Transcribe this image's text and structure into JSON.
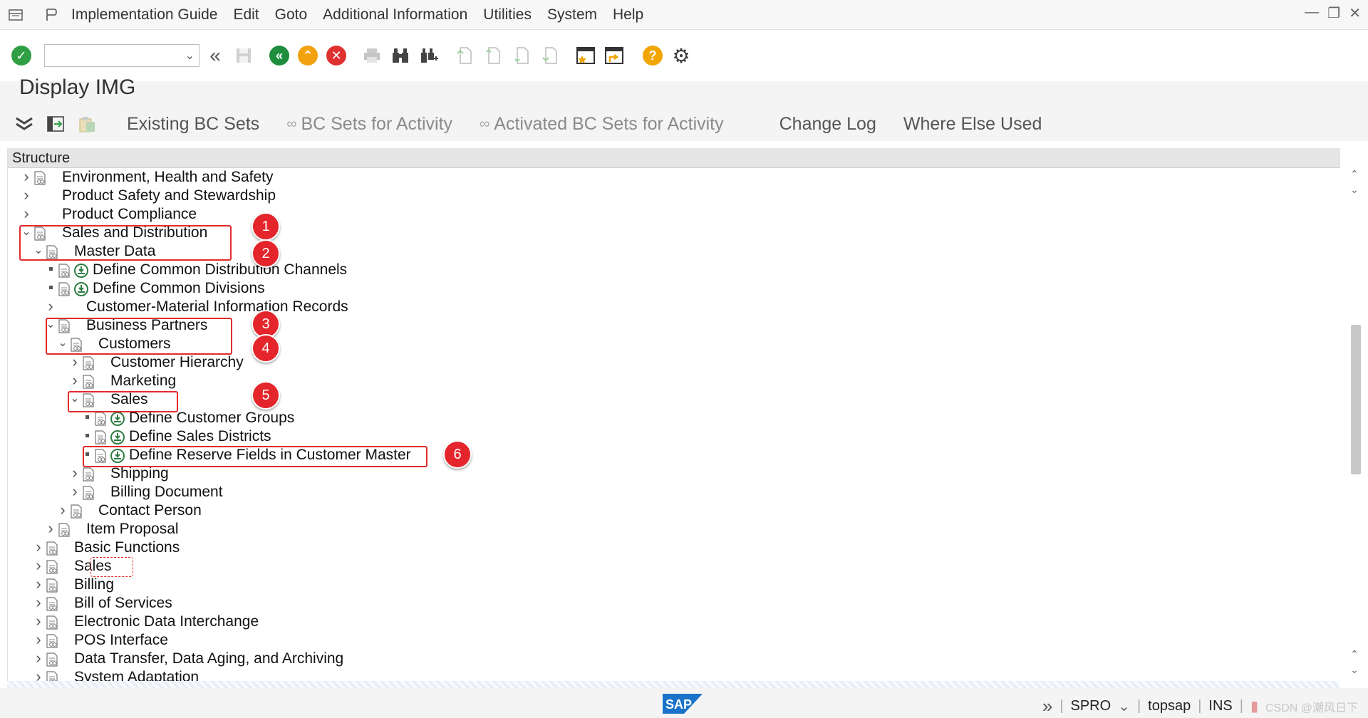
{
  "menu": {
    "items": [
      "Implementation Guide",
      "Edit",
      "Goto",
      "Additional Information",
      "Utilities",
      "System",
      "Help"
    ]
  },
  "toolbar": {
    "command_value": "",
    "icons": [
      "enter-icon",
      "command-dropdown",
      "back-double-icon",
      "save-icon",
      "back-icon",
      "exit-icon",
      "cancel-icon",
      "print-icon",
      "find-icon",
      "find-next-icon",
      "first-page-icon",
      "prev-page-icon",
      "next-page-icon",
      "last-page-icon",
      "new-session-icon",
      "shortcut-icon",
      "help-icon",
      "settings-icon"
    ]
  },
  "page": {
    "title": "Display IMG"
  },
  "app_toolbar": {
    "buttons": [
      {
        "label": "Existing BC Sets",
        "enabled": true
      },
      {
        "label": "BC Sets for Activity",
        "enabled": false
      },
      {
        "label": "Activated BC Sets for Activity",
        "enabled": false
      },
      {
        "label": "Change Log",
        "enabled": true
      },
      {
        "label": "Where Else Used",
        "enabled": true
      }
    ]
  },
  "tree": {
    "header": "Structure",
    "rows": [
      {
        "label": "Environment, Health and Safety",
        "level": 0,
        "state": "collapsed",
        "doc": true,
        "activity": false
      },
      {
        "label": "Product Safety and Stewardship",
        "level": 0,
        "state": "collapsed",
        "doc": false,
        "activity": false
      },
      {
        "label": "Product Compliance",
        "level": 0,
        "state": "collapsed",
        "doc": false,
        "activity": false
      },
      {
        "label": "Sales and Distribution",
        "level": 0,
        "state": "expanded",
        "doc": true,
        "activity": false
      },
      {
        "label": "Master Data",
        "level": 1,
        "state": "expanded",
        "doc": true,
        "activity": false
      },
      {
        "label": "Define Common Distribution Channels",
        "level": 2,
        "state": "leaf",
        "doc": true,
        "activity": true
      },
      {
        "label": "Define Common Divisions",
        "level": 2,
        "state": "leaf",
        "doc": true,
        "activity": true
      },
      {
        "label": "Customer-Material Information Records",
        "level": 2,
        "state": "collapsed",
        "doc": false,
        "activity": false
      },
      {
        "label": "Business Partners",
        "level": 2,
        "state": "expanded",
        "doc": true,
        "activity": false
      },
      {
        "label": "Customers",
        "level": 3,
        "state": "expanded",
        "doc": true,
        "activity": false
      },
      {
        "label": "Customer Hierarchy",
        "level": 4,
        "state": "collapsed",
        "doc": true,
        "activity": false
      },
      {
        "label": "Marketing",
        "level": 4,
        "state": "collapsed",
        "doc": true,
        "activity": false
      },
      {
        "label": "Sales",
        "level": 4,
        "state": "expanded",
        "doc": true,
        "activity": false
      },
      {
        "label": "Define Customer Groups",
        "level": 5,
        "state": "leaf",
        "doc": true,
        "activity": true
      },
      {
        "label": "Define Sales Districts",
        "level": 5,
        "state": "leaf",
        "doc": true,
        "activity": true
      },
      {
        "label": "Define Reserve Fields in Customer Master",
        "level": 5,
        "state": "leaf",
        "doc": true,
        "activity": true
      },
      {
        "label": "Shipping",
        "level": 4,
        "state": "collapsed",
        "doc": true,
        "activity": false
      },
      {
        "label": "Billing Document",
        "level": 4,
        "state": "collapsed",
        "doc": true,
        "activity": false
      },
      {
        "label": "Contact Person",
        "level": 3,
        "state": "collapsed",
        "doc": true,
        "activity": false
      },
      {
        "label": "Item Proposal",
        "level": 2,
        "state": "collapsed",
        "doc": true,
        "activity": false
      },
      {
        "label": "Basic Functions",
        "level": 1,
        "state": "collapsed",
        "doc": true,
        "activity": false
      },
      {
        "label": "Sales",
        "level": 1,
        "state": "collapsed",
        "doc": true,
        "activity": false
      },
      {
        "label": "Billing",
        "level": 1,
        "state": "collapsed",
        "doc": true,
        "activity": false
      },
      {
        "label": "Bill of Services",
        "level": 1,
        "state": "collapsed",
        "doc": true,
        "activity": false
      },
      {
        "label": "Electronic Data Interchange",
        "level": 1,
        "state": "collapsed",
        "doc": true,
        "activity": false
      },
      {
        "label": "POS Interface",
        "level": 1,
        "state": "collapsed",
        "doc": true,
        "activity": false
      },
      {
        "label": "Data Transfer, Data Aging, and Archiving",
        "level": 1,
        "state": "collapsed",
        "doc": true,
        "activity": false
      },
      {
        "label": "System Adaptation",
        "level": 1,
        "state": "collapsed",
        "doc": true,
        "activity": false
      }
    ]
  },
  "annotations": [
    "1",
    "2",
    "3",
    "4",
    "5",
    "6"
  ],
  "status": {
    "transaction": "SPRO",
    "system": "topsap",
    "mode": "INS",
    "watermark": "CSDN @潮风日下"
  },
  "colors": {
    "highlight": "#e32b2b",
    "badge": "#e4252b",
    "enter_green": "#2f9e44",
    "back_green": "#1e8e3e",
    "exit_orange": "#f2a10f",
    "cancel_red": "#e03131",
    "help_yellow": "#f0a500"
  }
}
